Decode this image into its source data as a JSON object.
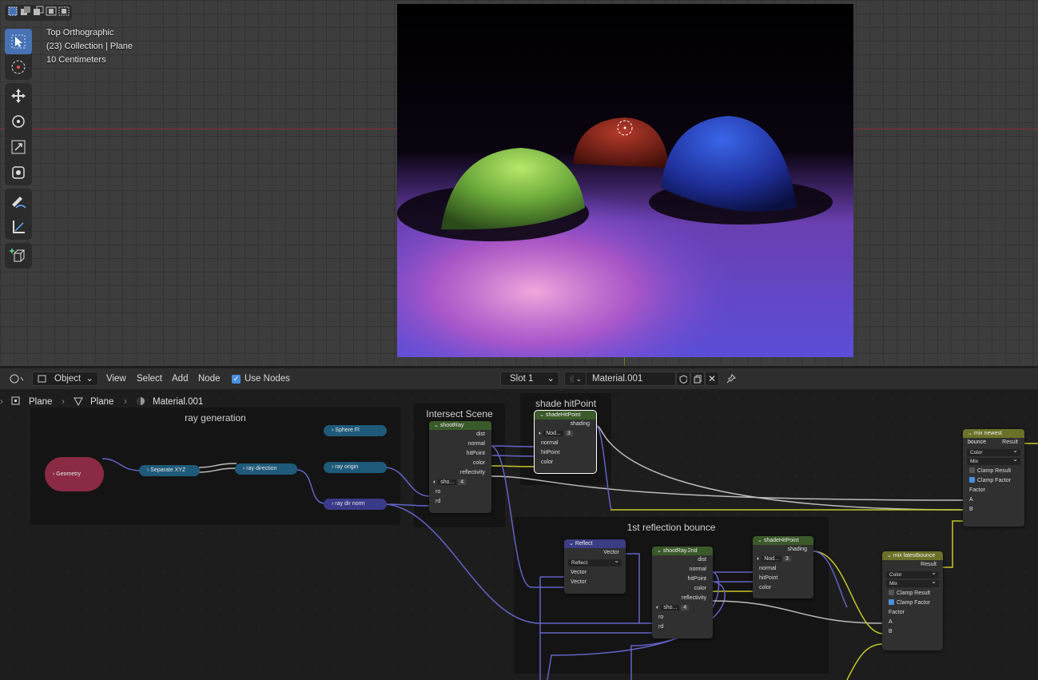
{
  "viewport": {
    "view_name": "Top Orthographic",
    "context": "(23) Collection | Plane",
    "scale": "10 Centimeters"
  },
  "header": {
    "object_mode": "Object",
    "menus": [
      "View",
      "Select",
      "Add",
      "Node"
    ],
    "use_nodes_label": "Use Nodes",
    "use_nodes_checked": true,
    "slot": "Slot 1",
    "material": "Material.001"
  },
  "breadcrumb": [
    "Plane",
    "Plane",
    "Material.001"
  ],
  "frames": {
    "ray_generation": "ray generation",
    "intersect_scene": "Intersect Scene",
    "shade_hitpoint": "shade hitPoint",
    "first_bounce": "1st reflection bounce"
  },
  "nodes": {
    "geometry": "Geometry",
    "separate_xyz": "Separate XYZ",
    "ray_direction": "ray direction",
    "sphere_fl": "Sphere Fl",
    "ray_origin": "ray origin",
    "ray_dir_norm": "ray dir norm",
    "shootray": {
      "title": "shootRay",
      "outputs": [
        "dist",
        "normal",
        "hitPoint",
        "color",
        "reflectivity"
      ],
      "group": "sho...",
      "users": "4",
      "inputs": [
        "ro",
        "rd"
      ]
    },
    "shadehitpoint": {
      "title": "shadeHitPoint",
      "output": "shading",
      "group": "Nod...",
      "users": "3",
      "inputs": [
        "normal",
        "hitPoint",
        "color"
      ]
    },
    "reflect": {
      "title": "Reflect",
      "output": "Vector",
      "mode": "Reflect",
      "inputs": [
        "Vector",
        "Vector"
      ]
    },
    "shootray2": {
      "title": "shootRay.2nd",
      "outputs": [
        "dist",
        "normal",
        "hitPoint",
        "color",
        "reflectivity"
      ],
      "group": "sho...",
      "users": "4",
      "inputs": [
        "ro",
        "rd"
      ]
    },
    "shadehitpoint2": {
      "title": "shadeHitPoint",
      "output": "shading",
      "group": "Nod...",
      "users": "3",
      "inputs": [
        "normal",
        "hitPoint",
        "color"
      ]
    },
    "mix_latest": {
      "title": "mix latestbounce",
      "output": "Result",
      "type": "Color",
      "blend": "Mix",
      "clamp_result": "Clamp Result",
      "clamp_factor": "Clamp Factor",
      "inputs": [
        "Factor",
        "A",
        "B"
      ]
    },
    "mix_newest": {
      "title": "mix newest bounce",
      "output": "Result",
      "type": "Color",
      "blend": "Mix",
      "clamp_result": "Clamp Result",
      "clamp_factor": "Clamp Factor",
      "inputs": [
        "Factor",
        "A",
        "B"
      ]
    }
  },
  "colors": {
    "accent": "#4772b3",
    "group_node_header": "#3b5a2a",
    "vector_socket": "#6363c7",
    "color_socket": "#c7c729",
    "float_socket": "#a1a1a1",
    "mix_header": "#6b7128",
    "reflect_header": "#3c3c83"
  }
}
